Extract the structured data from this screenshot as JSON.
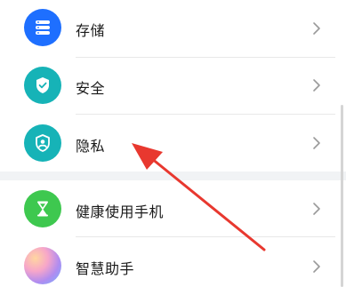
{
  "settings": {
    "items": [
      {
        "label": "存储",
        "icon": "storage-icon",
        "color": "#1e6fff"
      },
      {
        "label": "安全",
        "icon": "shield-icon",
        "color": "#16b3b7"
      },
      {
        "label": "隐私",
        "icon": "privacy-icon",
        "color": "#16b3b7"
      },
      {
        "label": "健康使用手机",
        "icon": "hourglass-icon",
        "color": "#3ec84f"
      },
      {
        "label": "智慧助手",
        "icon": "assistant-orb-icon",
        "color": "#b08cf0"
      }
    ]
  },
  "annotation": {
    "arrow_color": "#e8382f"
  }
}
